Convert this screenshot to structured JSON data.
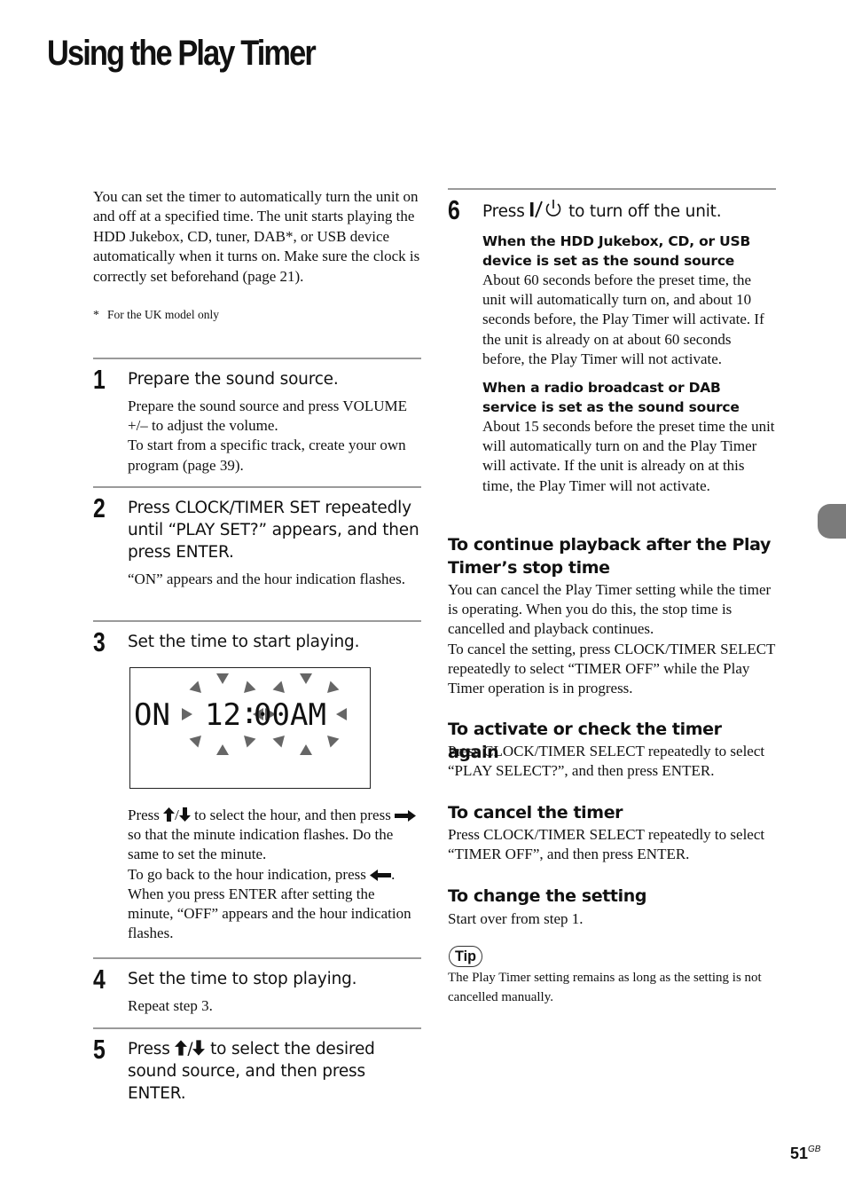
{
  "page": {
    "title": "Using the Play Timer",
    "page_number": "51",
    "page_region": "GB"
  },
  "intro": {
    "text": "You can set the timer to automatically turn the unit on and off at a specified time. The unit starts playing the HDD Jukebox, CD, tuner, DAB*, or USB device automatically when it turns on. Make sure the clock is correctly set beforehand (page 21).",
    "footnote_mark": "*",
    "footnote": "For the UK model only"
  },
  "steps": [
    {
      "number": "1",
      "heading": "Prepare the sound source.",
      "body": [
        "Prepare the sound source and press VOLUME +/– to adjust the volume.",
        "To start from a specific track, create your own program (page 39)."
      ]
    },
    {
      "number": "2",
      "heading": "Press CLOCK/TIMER SET repeatedly until “PLAY SET?” appears, and then press ENTER.",
      "body": [
        "“ON” appears and the hour indication flashes."
      ]
    },
    {
      "number": "3",
      "heading": "Set the time to start playing.",
      "display": {
        "mode": "ON",
        "hour": "12",
        "separator": ":",
        "minute": "00",
        "period": "AM"
      },
      "body": {
        "p1_pre": "Press",
        "p1_mid": "/",
        "p1_post": "to select the hour, and then press",
        "p2_post": "so that the minute indication flashes. Do the same to set the minute.",
        "p3_pre": "To go back to the hour indication, press",
        "p3_post": ".",
        "p4": "When you press ENTER after setting the minute, “OFF” appears and the hour indication flashes."
      }
    },
    {
      "number": "4",
      "heading": "Set the time to stop playing.",
      "body": [
        "Repeat step 3."
      ]
    },
    {
      "number": "5",
      "heading_pre": "Press",
      "heading_mid": "/",
      "heading_post": "to select the desired sound source, and then press ENTER."
    },
    {
      "number": "6",
      "heading_pre": "Press",
      "heading_post": "to turn off the unit.",
      "subsections": [
        {
          "title": "When the HDD Jukebox, CD, or USB device is set as the sound source",
          "body": "About 60 seconds before the preset time, the unit will automatically turn on, and about 10 seconds before, the Play Timer will activate. If the unit is already on at about 60 seconds before, the Play Timer will not activate."
        },
        {
          "title": "When a radio broadcast or DAB service is set as the sound source",
          "body": "About 15 seconds before the preset time the unit will automatically turn on and the Play Timer will activate. If the unit is already on at this time, the Play Timer will not activate."
        }
      ]
    }
  ],
  "sections": [
    {
      "heading": "To continue playback after the Play Timer’s stop time",
      "body": [
        "You can cancel the Play Timer setting while the timer is operating. When you do this, the stop time is cancelled and playback continues.",
        "To cancel the setting, press CLOCK/TIMER SELECT repeatedly to select “TIMER OFF” while the Play Timer operation is in progress."
      ]
    },
    {
      "heading": "To activate or check the timer again",
      "body": [
        "Press CLOCK/TIMER SELECT repeatedly to select “PLAY SELECT?”, and then press ENTER."
      ]
    },
    {
      "heading": "To cancel the timer",
      "body": [
        "Press CLOCK/TIMER SELECT repeatedly to select “TIMER OFF”, and then press ENTER."
      ]
    },
    {
      "heading": "To change the setting",
      "body": [
        "Start over from step 1."
      ]
    }
  ],
  "tip": {
    "label": "Tip",
    "text": "The Play Timer setting remains as long as the setting is not cancelled manually."
  },
  "icons": {
    "up": "up-arrow-icon",
    "down": "down-arrow-icon",
    "right": "right-arrow-icon",
    "left": "left-arrow-icon",
    "power": "power-standby-icon",
    "flash": "flash-indicator-icon"
  },
  "colors": {
    "rule": "#9a9a9a",
    "side_tab": "#7b7b7b",
    "flash_rays": "#666666"
  }
}
